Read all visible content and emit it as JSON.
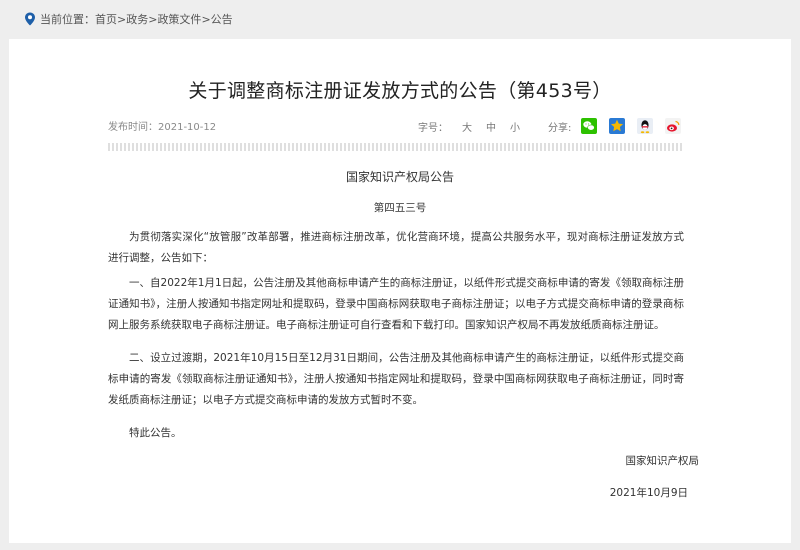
{
  "breadcrumb": {
    "prefix": "当前位置：",
    "items": [
      "首页",
      "政务",
      "政策文件",
      "公告"
    ],
    "separator": ">"
  },
  "article": {
    "title": "关于调整商标注册证发放方式的公告（第453号）",
    "publish_date": "发布时间：2021-10-12",
    "font_size_label": "字号：",
    "font_sizes": [
      "大",
      "中",
      "小"
    ],
    "share_label": "分享:",
    "share_icons": [
      "wechat-icon",
      "qzone-icon",
      "qq-icon",
      "weibo-icon"
    ],
    "office": "国家知识产权局公告",
    "number": "第四五三号",
    "paragraphs": [
      "为贯彻落实深化“放管服”改革部署，推进商标注册改革，优化营商环境，提高公共服务水平，现对商标注册证发放方式进行调整，公告如下：",
      "一、自2022年1月1日起，公告注册及其他商标申请产生的商标注册证，以纸件形式提交商标申请的寄发《领取商标注册证通知书》，注册人按通知书指定网址和提取码，登录中国商标网获取电子商标注册证；以电子方式提交商标申请的登录商标网上服务系统获取电子商标注册证。电子商标注册证可自行查看和下载打印。国家知识产权局不再发放纸质商标注册证。",
      "二、设立过渡期，2021年10月15日至12月31日期间，公告注册及其他商标申请产生的商标注册证，以纸件形式提交商标申请的寄发《领取商标注册证通知书》，注册人按通知书指定网址和提取码，登录中国商标网获取电子商标注册证，同时寄发纸质商标注册证；以电子方式提交商标申请的发放方式暂时不变。",
      "特此公告。"
    ],
    "signature_org": "国家知识产权局",
    "signature_date": "2021年10月9日"
  },
  "colors": {
    "background": "#eeeeee",
    "panel": "#ffffff",
    "pin": "#1e5fa8",
    "wechat": "#2dc100",
    "qzone": "#f5b800",
    "weibo": "#e6162d"
  }
}
